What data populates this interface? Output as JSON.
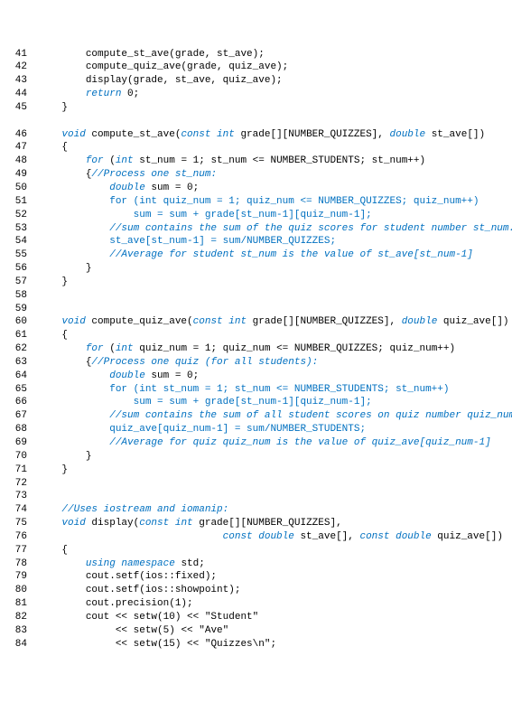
{
  "kw_void": "void",
  "kw_const": "const",
  "kw_int": "int",
  "kw_double": "double",
  "kw_for": "for",
  "kw_return": "return",
  "kw_using": "using",
  "kw_namespace": "namespace",
  "lines": {
    "41": {
      "num": "41",
      "indent": "        ",
      "seg": [
        [
          "p",
          "compute_st_ave(grade, st_ave);"
        ]
      ]
    },
    "42": {
      "num": "42",
      "indent": "        ",
      "seg": [
        [
          "p",
          "compute_quiz_ave(grade, quiz_ave);"
        ]
      ]
    },
    "43": {
      "num": "43",
      "indent": "        ",
      "seg": [
        [
          "p",
          "display(grade, st_ave, quiz_ave);"
        ]
      ]
    },
    "44": {
      "num": "44",
      "indent": "        ",
      "seg": [
        [
          "kw",
          "return"
        ],
        [
          "p",
          " 0;"
        ]
      ]
    },
    "45": {
      "num": "45",
      "indent": "    ",
      "seg": [
        [
          "p",
          "}"
        ]
      ]
    },
    "46": {
      "num": "46",
      "indent": "    ",
      "seg": [
        [
          "kw",
          "void"
        ],
        [
          "p",
          " compute_st_ave("
        ],
        [
          "kw",
          "const int"
        ],
        [
          "p",
          " grade[][NUMBER_QUIZZES], "
        ],
        [
          "kw",
          "double"
        ],
        [
          "p",
          " st_ave[])"
        ]
      ]
    },
    "47": {
      "num": "47",
      "indent": "    ",
      "seg": [
        [
          "p",
          "{"
        ]
      ]
    },
    "48": {
      "num": "48",
      "indent": "        ",
      "seg": [
        [
          "kw",
          "for"
        ],
        [
          "p",
          " ("
        ],
        [
          "kw",
          "int"
        ],
        [
          "p",
          " st_num = 1; st_num <= NUMBER_STUDENTS; st_num++)"
        ]
      ]
    },
    "49": {
      "num": "49",
      "indent": "        ",
      "seg": [
        [
          "p",
          "{"
        ],
        [
          "cm",
          "//Process one st_num:"
        ]
      ]
    },
    "50": {
      "num": "50",
      "indent": "            ",
      "seg": [
        [
          "kw",
          "double"
        ],
        [
          "p",
          " sum = 0;"
        ]
      ]
    },
    "51": {
      "num": "51",
      "indent": "            ",
      "seg": [
        [
          "hl",
          "for (int quiz_num = 1; quiz_num <= NUMBER_QUIZZES; quiz_num++)"
        ]
      ]
    },
    "52": {
      "num": "52",
      "indent": "                ",
      "seg": [
        [
          "hl",
          "sum = sum + grade[st_num-1][quiz_num-1];"
        ]
      ]
    },
    "53": {
      "num": "53",
      "indent": "            ",
      "seg": [
        [
          "cm",
          "//sum contains the sum of the quiz scores for student number st_num."
        ]
      ]
    },
    "54": {
      "num": "54",
      "indent": "            ",
      "seg": [
        [
          "hl",
          "st_ave[st_num-1] = sum/NUMBER_QUIZZES;"
        ]
      ]
    },
    "55": {
      "num": "55",
      "indent": "            ",
      "seg": [
        [
          "cm",
          "//Average for student st_num is the value of st_ave[st_num-1]"
        ]
      ]
    },
    "56": {
      "num": "56",
      "indent": "        ",
      "seg": [
        [
          "p",
          "}"
        ]
      ]
    },
    "57": {
      "num": "57",
      "indent": "    ",
      "seg": [
        [
          "p",
          "}"
        ]
      ]
    },
    "58": {
      "num": "58",
      "indent": "",
      "seg": [
        [
          "p",
          ""
        ]
      ]
    },
    "59": {
      "num": "59",
      "indent": "",
      "seg": [
        [
          "p",
          ""
        ]
      ]
    },
    "60": {
      "num": "60",
      "indent": "    ",
      "seg": [
        [
          "kw",
          "void"
        ],
        [
          "p",
          " compute_quiz_ave("
        ],
        [
          "kw",
          "const int"
        ],
        [
          "p",
          " grade[][NUMBER_QUIZZES], "
        ],
        [
          "kw",
          "double"
        ],
        [
          "p",
          " quiz_ave[])"
        ]
      ]
    },
    "61": {
      "num": "61",
      "indent": "    ",
      "seg": [
        [
          "p",
          "{"
        ]
      ]
    },
    "62": {
      "num": "62",
      "indent": "        ",
      "seg": [
        [
          "kw",
          "for"
        ],
        [
          "p",
          " ("
        ],
        [
          "kw",
          "int"
        ],
        [
          "p",
          " quiz_num = 1; quiz_num <= NUMBER_QUIZZES; quiz_num++)"
        ]
      ]
    },
    "63": {
      "num": "63",
      "indent": "        ",
      "seg": [
        [
          "p",
          "{"
        ],
        [
          "cm",
          "//Process one quiz (for all students):"
        ]
      ]
    },
    "64": {
      "num": "64",
      "indent": "            ",
      "seg": [
        [
          "kw",
          "double"
        ],
        [
          "p",
          " sum = 0;"
        ]
      ]
    },
    "65": {
      "num": "65",
      "indent": "            ",
      "seg": [
        [
          "hl",
          "for (int st_num = 1; st_num <= NUMBER_STUDENTS; st_num++)"
        ]
      ]
    },
    "66": {
      "num": "66",
      "indent": "                ",
      "seg": [
        [
          "hl",
          "sum = sum + grade[st_num-1][quiz_num-1];"
        ]
      ]
    },
    "67": {
      "num": "67",
      "indent": "            ",
      "seg": [
        [
          "cm",
          "//sum contains the sum of all student scores on quiz number quiz_num."
        ]
      ]
    },
    "68": {
      "num": "68",
      "indent": "            ",
      "seg": [
        [
          "hl",
          "quiz_ave[quiz_num-1] = sum/NUMBER_STUDENTS;"
        ]
      ]
    },
    "69": {
      "num": "69",
      "indent": "            ",
      "seg": [
        [
          "cm",
          "//Average for quiz quiz_num is the value of quiz_ave[quiz_num-1]"
        ]
      ]
    },
    "70": {
      "num": "70",
      "indent": "        ",
      "seg": [
        [
          "p",
          "}"
        ]
      ]
    },
    "71": {
      "num": "71",
      "indent": "    ",
      "seg": [
        [
          "p",
          "}"
        ]
      ]
    },
    "72": {
      "num": "72",
      "indent": "",
      "seg": [
        [
          "p",
          ""
        ]
      ]
    },
    "73": {
      "num": "73",
      "indent": "",
      "seg": [
        [
          "p",
          ""
        ]
      ]
    },
    "74": {
      "num": "74",
      "indent": "    ",
      "seg": [
        [
          "cm",
          "//Uses iostream and iomanip:"
        ]
      ]
    },
    "75": {
      "num": "75",
      "indent": "    ",
      "seg": [
        [
          "kw",
          "void"
        ],
        [
          "p",
          " display("
        ],
        [
          "kw",
          "const int"
        ],
        [
          "p",
          " grade[][NUMBER_QUIZZES],"
        ]
      ]
    },
    "76": {
      "num": "76",
      "indent": "                               ",
      "seg": [
        [
          "kw",
          "const double"
        ],
        [
          "p",
          " st_ave[], "
        ],
        [
          "kw",
          "const double"
        ],
        [
          "p",
          " quiz_ave[])"
        ]
      ]
    },
    "77": {
      "num": "77",
      "indent": "    ",
      "seg": [
        [
          "p",
          "{"
        ]
      ]
    },
    "78": {
      "num": "78",
      "indent": "        ",
      "seg": [
        [
          "kw",
          "using namespace"
        ],
        [
          "p",
          " std;"
        ]
      ]
    },
    "79": {
      "num": "79",
      "indent": "        ",
      "seg": [
        [
          "p",
          "cout.setf(ios::fixed);"
        ]
      ]
    },
    "80": {
      "num": "80",
      "indent": "        ",
      "seg": [
        [
          "p",
          "cout.setf(ios::showpoint);"
        ]
      ]
    },
    "81": {
      "num": "81",
      "indent": "        ",
      "seg": [
        [
          "p",
          "cout.precision(1);"
        ]
      ]
    },
    "82": {
      "num": "82",
      "indent": "        ",
      "seg": [
        [
          "p",
          "cout << setw(10) << \"Student\""
        ]
      ]
    },
    "83": {
      "num": "83",
      "indent": "             ",
      "seg": [
        [
          "p",
          "<< setw(5) << \"Ave\""
        ]
      ]
    },
    "84": {
      "num": "84",
      "indent": "             ",
      "seg": [
        [
          "p",
          "<< setw(15) << \"Quizzes\\n\";"
        ]
      ]
    }
  },
  "order": [
    "41",
    "42",
    "43",
    "44",
    "45",
    "blank",
    "46",
    "47",
    "48",
    "49",
    "50",
    "51",
    "52",
    "53",
    "54",
    "55",
    "56",
    "57",
    "58",
    "59",
    "60",
    "61",
    "62",
    "63",
    "64",
    "65",
    "66",
    "67",
    "68",
    "69",
    "70",
    "71",
    "72",
    "73",
    "74",
    "75",
    "76",
    "77",
    "78",
    "79",
    "80",
    "81",
    "82",
    "83",
    "84"
  ]
}
